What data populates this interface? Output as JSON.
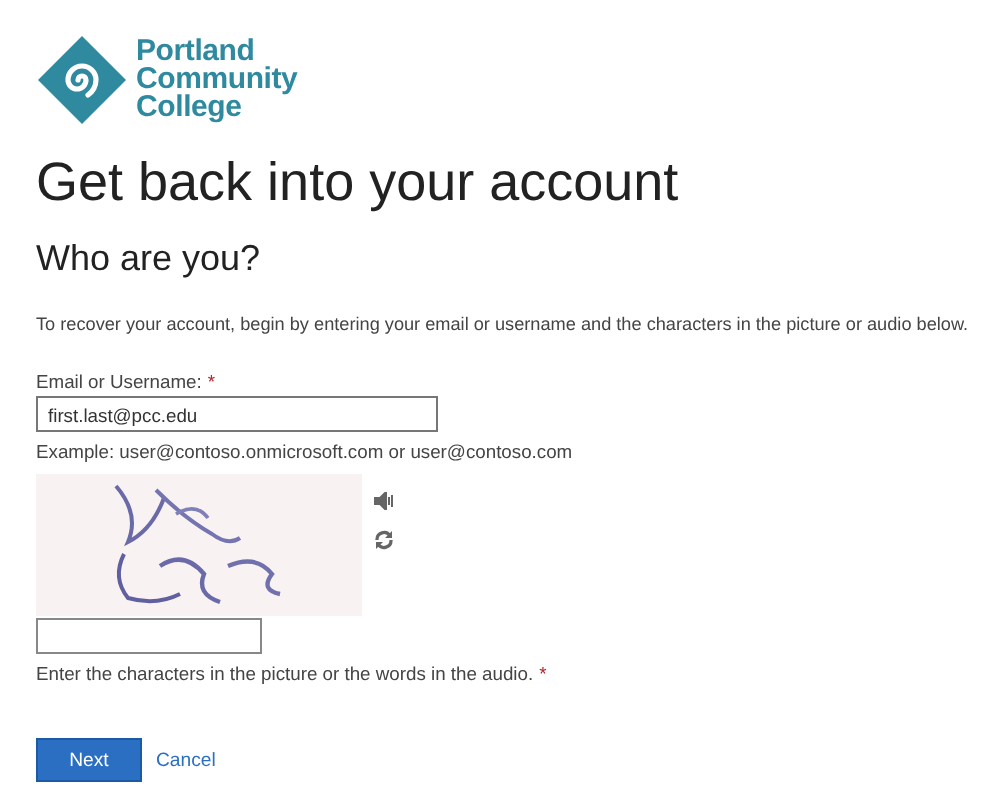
{
  "logo": {
    "lines": [
      "Portland",
      "Community",
      "College"
    ]
  },
  "title": "Get back into your account",
  "subtitle": "Who are you?",
  "intro": "To recover your account, begin by entering your email or username and the characters in the picture or audio below.",
  "email": {
    "label": "Email or Username:",
    "required_mark": "*",
    "value": "first.last@pcc.edu",
    "example": "Example: user@contoso.onmicrosoft.com or user@contoso.com"
  },
  "captcha": {
    "answer": {
      "hint": "Enter the characters in the picture or the words in the audio.",
      "required_mark": "*"
    }
  },
  "buttons": [
    {
      "kind": "primary",
      "label": "Next"
    },
    {
      "kind": "link",
      "label": "Cancel"
    }
  ]
}
